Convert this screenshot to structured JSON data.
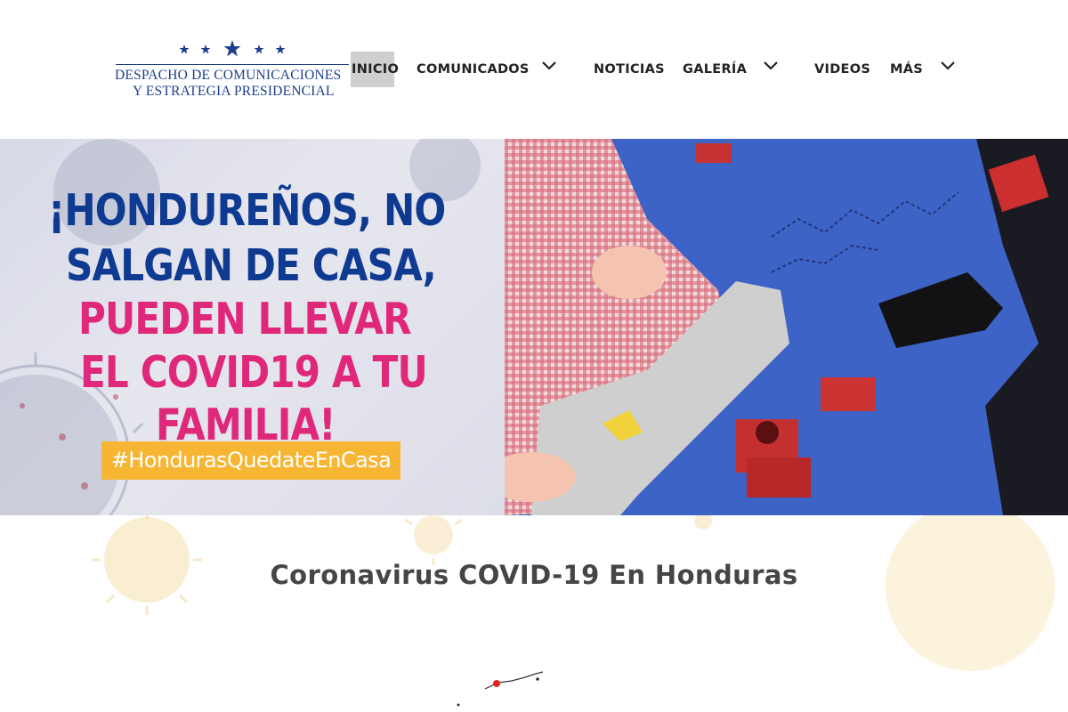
{
  "header": {
    "logo_line1": "DESPACHO DE COMUNICACIONES",
    "logo_line2": "Y ESTRATEGIA PRESIDENCIAL"
  },
  "nav": {
    "items": [
      {
        "label": "INICIO",
        "active": true,
        "has_dropdown": false
      },
      {
        "label": "COMUNICADOS",
        "active": false,
        "has_dropdown": true
      },
      {
        "label": "NOTICIAS",
        "active": false,
        "has_dropdown": false
      },
      {
        "label": "GALERÍA",
        "active": false,
        "has_dropdown": true
      },
      {
        "label": "VIDEOS",
        "active": false,
        "has_dropdown": false
      },
      {
        "label": "MÁS",
        "active": false,
        "has_dropdown": true
      }
    ]
  },
  "hero": {
    "line1": "¡HONDUREÑOS, NO",
    "line2": "SALGAN DE CASA,",
    "line3": "PUEDEN LLEVAR",
    "line4": "EL COVID19 A TU",
    "line5": "FAMILIA!",
    "hashtag": "#HondurasQuedateEnCasa"
  },
  "section": {
    "title": "Coronavirus COVID-19 En Honduras"
  },
  "colors": {
    "brand_blue": "#0e3a92",
    "brand_pink": "#e0287a",
    "hashtag_bg": "#f6b533",
    "nav_active_bg": "#cfcfcf",
    "mat_blue": "#3f63c7"
  }
}
